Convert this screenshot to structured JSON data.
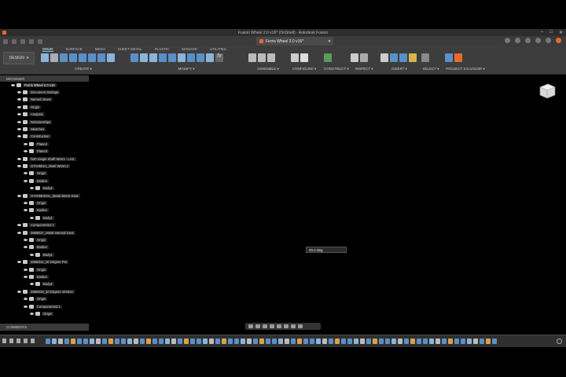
{
  "window": {
    "title": "Fusion Wheel 2.0 v16* (OnShell) - Autodesk Fusion",
    "controls": [
      "–",
      "□",
      "✕"
    ]
  },
  "document_tab": {
    "label": "Ferris Wheel 2.0 v16*"
  },
  "toolbar": {
    "workspace_label": "DESIGN",
    "workspace_tabs": [
      "SOLID",
      "SURFACE",
      "MESH",
      "SHEET METAL",
      "PLASTIC",
      "MANAGE",
      "UTILITIES"
    ],
    "groups": [
      "CREATE ▾",
      "MODIFY ▾",
      "ASSEMBLE ▾",
      "CONFIGURE ▾",
      "CONSTRUCT ▾",
      "INSPECT ▾",
      "INSERT ▾",
      "SELECT ▾",
      "PROJECT SALVADOR ▾"
    ]
  },
  "browser": {
    "title": "BROWSER",
    "items": [
      {
        "label": "Ferris Wheel 2.0 v16",
        "level": 0,
        "root": true
      },
      {
        "label": "Document Settings",
        "level": 1
      },
      {
        "label": "Named Views",
        "level": 1
      },
      {
        "label": "Origin",
        "level": 1
      },
      {
        "label": "Analysis",
        "level": 1
      },
      {
        "label": "Relationships",
        "level": 1
      },
      {
        "label": "Sketches",
        "level": 1
      },
      {
        "label": "Construction",
        "level": 1
      },
      {
        "label": "Plane2",
        "level": 2
      },
      {
        "label": "Plane3",
        "level": 2
      },
      {
        "label": "N20 Single Shaft Worm - LAS:",
        "level": 1
      },
      {
        "label": "GTA05E21_Steel Worm:1",
        "level": 1
      },
      {
        "label": "Origin",
        "level": 2
      },
      {
        "label": "Bodies",
        "level": 2
      },
      {
        "label": "Body1",
        "level": 3
      },
      {
        "label": "GTA05E20AL_Metal Worm Gear",
        "level": 1
      },
      {
        "label": "Origin",
        "level": 2
      },
      {
        "label": "Bodies",
        "level": 2
      },
      {
        "label": "Body1",
        "level": 3
      },
      {
        "label": "Component21:1",
        "level": 1
      },
      {
        "label": "2868E27_Metal Internal Gear",
        "level": 1
      },
      {
        "label": "Origin",
        "level": 2
      },
      {
        "label": "Bodies",
        "level": 2
      },
      {
        "label": "Body1",
        "level": 3
      },
      {
        "label": "2868S22_20 Degree Pre",
        "level": 1
      },
      {
        "label": "Origin",
        "level": 2
      },
      {
        "label": "Bodies",
        "level": 2
      },
      {
        "label": "Body1",
        "level": 3
      },
      {
        "label": "2868S28_20 Degree Version",
        "level": 1
      },
      {
        "label": "Origin",
        "level": 2
      },
      {
        "label": "Component22:1",
        "level": 2
      },
      {
        "label": "Origin",
        "level": 3
      }
    ]
  },
  "comments_label": "COMMENTS",
  "viewport": {
    "angle_input": "20.0 deg"
  },
  "colors": {
    "accent": "#e8692c",
    "highlight": "#6cf",
    "background": "#474747"
  }
}
